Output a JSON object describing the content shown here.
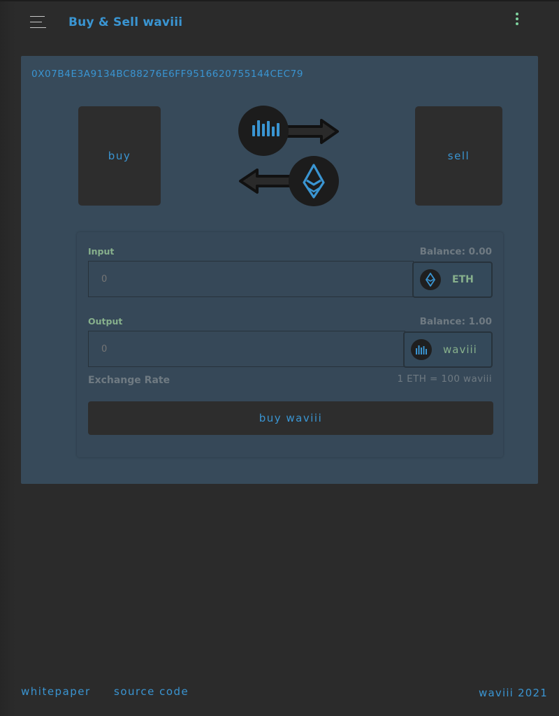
{
  "header": {
    "title": "Buy & Sell waviii",
    "menu_icon": "hamburger-menu-icon",
    "more_icon": "more-vertical-icon"
  },
  "wallet": {
    "address": "0X07B4E3A9134BC88276E6FF9516620755144CEC79"
  },
  "mode": {
    "buy_label": "Buy",
    "sell_label": "Sell"
  },
  "form": {
    "input": {
      "label": "Input",
      "balance": "Balance: 0.00",
      "placeholder": "0",
      "token": "ETH",
      "token_icon": "ethereum-icon"
    },
    "output": {
      "label": "Output",
      "balance": "Balance: 1.00",
      "placeholder": "0",
      "token": "waviii",
      "token_icon": "waviii-icon"
    },
    "rate_label": "Exchange Rate",
    "rate_value": "1 ETH = 100 waviii",
    "submit_label": "Buy waviii"
  },
  "footer": {
    "whitepaper": "whitepaper",
    "source_code": "source code",
    "copyright": "waviii 2021"
  },
  "colors": {
    "accent": "#3a95d2",
    "label_green": "#87b08c",
    "background": "#2b2b2b",
    "card": "#374a5a"
  }
}
